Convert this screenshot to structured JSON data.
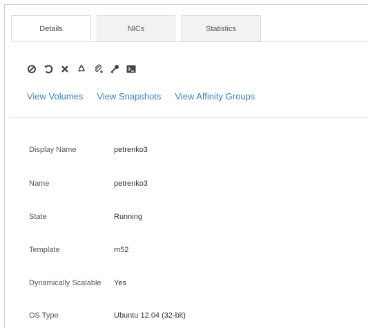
{
  "tabs": [
    {
      "label": "Details",
      "active": true
    },
    {
      "label": "NICs",
      "active": false
    },
    {
      "label": "Statistics",
      "active": false
    }
  ],
  "toolbar": {
    "icons": [
      "stop-icon",
      "reboot-icon",
      "destroy-icon",
      "recycle-icon",
      "attach-iso-icon",
      "reset-password-icon",
      "console-icon"
    ]
  },
  "links": {
    "volumes": "View Volumes",
    "snapshots": "View Snapshots",
    "affinity": "View Affinity Groups"
  },
  "details": [
    {
      "label": "Display Name",
      "value": "petrenko3"
    },
    {
      "label": "Name",
      "value": "petrenko3"
    },
    {
      "label": "State",
      "value": "Running"
    },
    {
      "label": "Template",
      "value": "m52"
    },
    {
      "label": "Dynamically Scalable",
      "value": "Yes"
    },
    {
      "label": "OS Type",
      "value": "Ubuntu 12.04 (32-bit)"
    }
  ],
  "colors": {
    "link": "#3a7fc1",
    "border": "#dcdcdc",
    "tab_inactive_bg": "#f2f2f2"
  }
}
